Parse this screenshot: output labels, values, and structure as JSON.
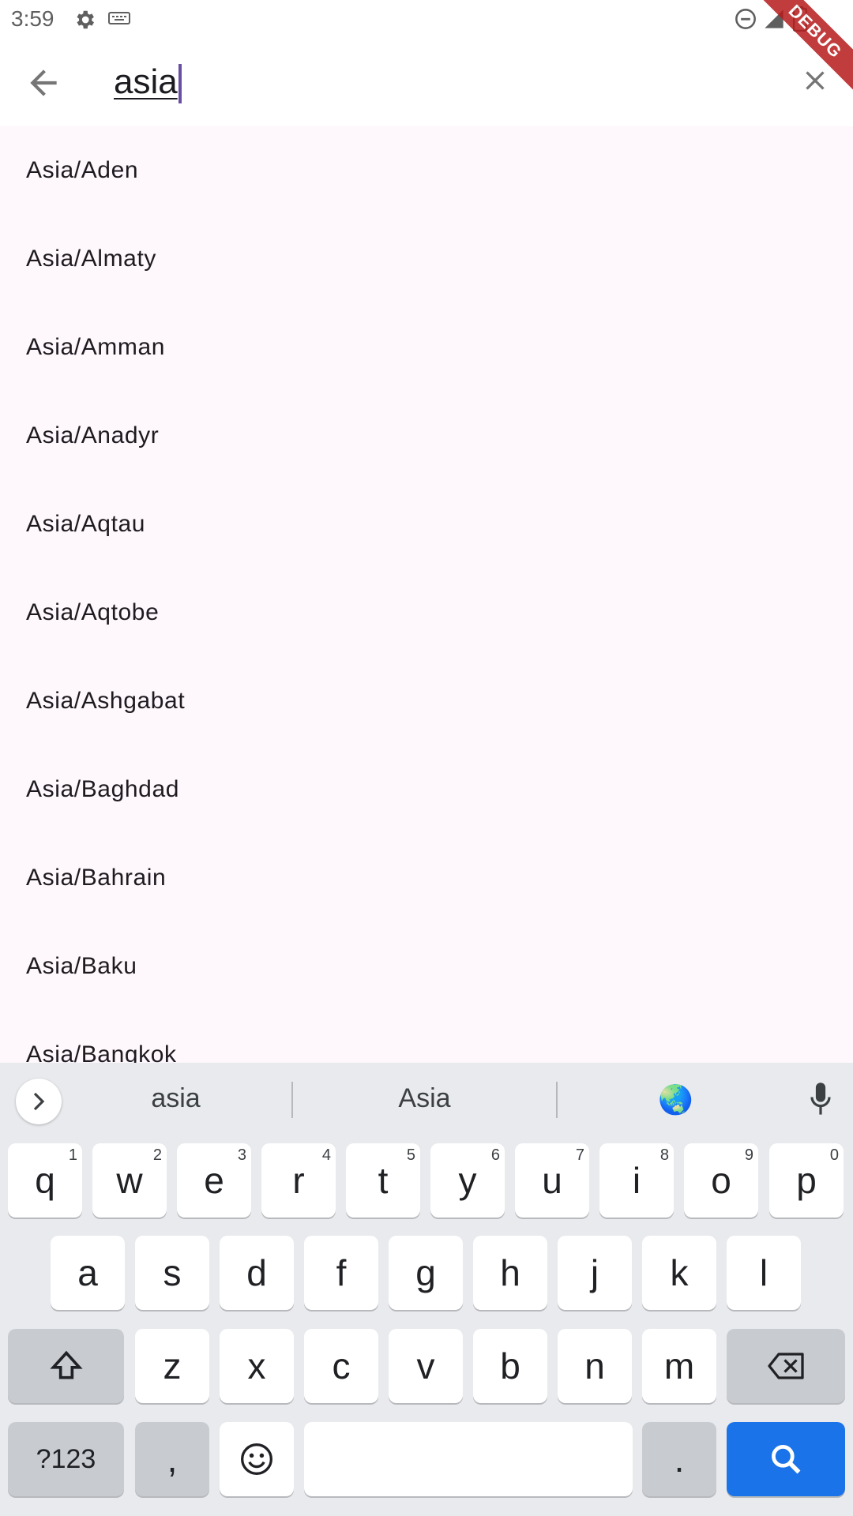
{
  "status_bar": {
    "time": "3:59",
    "icons": [
      "gear-icon",
      "keyboard-icon",
      "dnd-icon",
      "signal-icon",
      "battery-icon"
    ],
    "debug_label": "DEBUG"
  },
  "app_bar": {
    "back_icon": "arrow-left-icon",
    "search_value": "asia",
    "clear_icon": "close-icon",
    "cursor_color": "#6750a4"
  },
  "results": [
    "Asia/Aden",
    "Asia/Almaty",
    "Asia/Amman",
    "Asia/Anadyr",
    "Asia/Aqtau",
    "Asia/Aqtobe",
    "Asia/Ashgabat",
    "Asia/Baghdad",
    "Asia/Bahrain",
    "Asia/Baku",
    "Asia/Bangkok"
  ],
  "keyboard": {
    "suggestions": [
      "asia",
      "Asia",
      "🌏"
    ],
    "row1": [
      {
        "key": "q",
        "hint": "1"
      },
      {
        "key": "w",
        "hint": "2"
      },
      {
        "key": "e",
        "hint": "3"
      },
      {
        "key": "r",
        "hint": "4"
      },
      {
        "key": "t",
        "hint": "5"
      },
      {
        "key": "y",
        "hint": "6"
      },
      {
        "key": "u",
        "hint": "7"
      },
      {
        "key": "i",
        "hint": "8"
      },
      {
        "key": "o",
        "hint": "9"
      },
      {
        "key": "p",
        "hint": "0"
      }
    ],
    "row2": [
      "a",
      "s",
      "d",
      "f",
      "g",
      "h",
      "j",
      "k",
      "l"
    ],
    "row3": [
      "z",
      "x",
      "c",
      "v",
      "b",
      "n",
      "m"
    ],
    "symbols_label": "?123",
    "comma_label": ",",
    "period_label": ".",
    "accent_color": "#1a73e8"
  }
}
